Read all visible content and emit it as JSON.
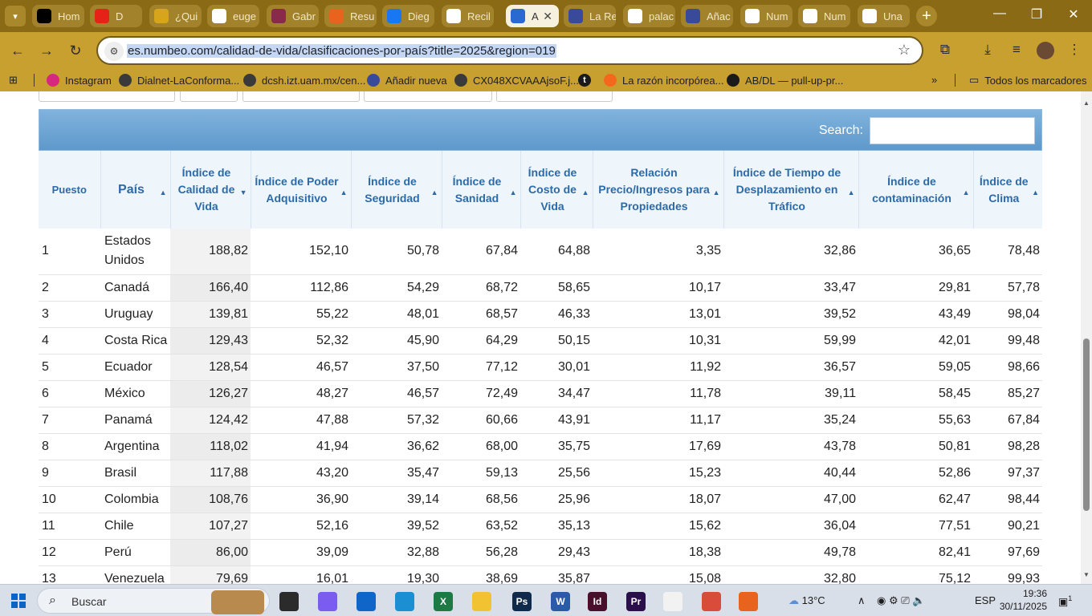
{
  "browser": {
    "tabs": [
      {
        "label": "Hom",
        "icon": "x-twitter-icon",
        "color": "#000000"
      },
      {
        "label": "D",
        "icon": "youtube-icon",
        "color": "#e62117"
      },
      {
        "label": "¿Qui",
        "icon": "coin-icon",
        "color": "#d7a51c"
      },
      {
        "label": "euge",
        "icon": "google-icon",
        "color": "#ffffff"
      },
      {
        "label": "Gabr",
        "icon": "uam-icon",
        "color": "#8a2a4a"
      },
      {
        "label": "Resu",
        "icon": "pdf-icon",
        "color": "#e8641e"
      },
      {
        "label": "Dieg",
        "icon": "facebook-icon",
        "color": "#1877f2"
      },
      {
        "label": "Recil",
        "icon": "gmail-icon",
        "color": "#ffffff"
      },
      {
        "label": "A",
        "icon": "numbeo-icon",
        "color": "#2a6ad0",
        "active": true
      },
      {
        "label": "La Re",
        "icon": "tab-icon",
        "color": "#3a4a9a"
      },
      {
        "label": "palac",
        "icon": "google-icon",
        "color": "#ffffff"
      },
      {
        "label": "Añac",
        "icon": "tab-icon",
        "color": "#3a4a9a"
      },
      {
        "label": "Num",
        "icon": "wikipedia-icon",
        "color": "#ffffff"
      },
      {
        "label": "Num",
        "icon": "wikipedia-icon",
        "color": "#ffffff"
      },
      {
        "label": "Una",
        "icon": "document-icon",
        "color": "#ffffff"
      }
    ],
    "url": "es.numbeo.com/calidad-de-vida/clasificaciones-por-país?title=2025&region=019",
    "bookmarks": [
      {
        "label": "Instagram",
        "color": "#d6287f"
      },
      {
        "label": "Dialnet-LaConforma...",
        "color": "#3a3a3a"
      },
      {
        "label": "dcsh.izt.uam.mx/cen...",
        "color": "#3a3a3a"
      },
      {
        "label": "Añadir nueva",
        "color": "#3a4a9a"
      },
      {
        "label": "CX048XCVAAAjsoF.j...",
        "color": "#3a3a3a"
      },
      {
        "label": "t",
        "color": "#1b1b1b"
      },
      {
        "label": "La razón incorpórea...",
        "color": "#f4681e"
      },
      {
        "label": "AB/DL — pull-up-pr...",
        "color": "#1b1b1b"
      }
    ],
    "bookmarks_overflow": "»",
    "all_bookmarks": "Todos los marcadores"
  },
  "search": {
    "label": "Search:",
    "value": ""
  },
  "table": {
    "headers": [
      "Puesto",
      "País",
      "Índice de Calidad de Vida",
      "Índice de Poder Adquisitivo",
      "Índice de Seguridad",
      "Índice de Sanidad",
      "Índice de Costo de Vida",
      "Relación Precio/Ingresos para Propiedades",
      "Índice de Tiempo de Desplazamiento en Tráfico",
      "Índice de contaminación",
      "Índice de Clima"
    ],
    "rows": [
      [
        "1",
        "Estados Unidos",
        "188,82",
        "152,10",
        "50,78",
        "67,84",
        "64,88",
        "3,35",
        "32,86",
        "36,65",
        "78,48"
      ],
      [
        "2",
        "Canadá",
        "166,40",
        "112,86",
        "54,29",
        "68,72",
        "58,65",
        "10,17",
        "33,47",
        "29,81",
        "57,78"
      ],
      [
        "3",
        "Uruguay",
        "139,81",
        "55,22",
        "48,01",
        "68,57",
        "46,33",
        "13,01",
        "39,52",
        "43,49",
        "98,04"
      ],
      [
        "4",
        "Costa Rica",
        "129,43",
        "52,32",
        "45,90",
        "64,29",
        "50,15",
        "10,31",
        "59,99",
        "42,01",
        "99,48"
      ],
      [
        "5",
        "Ecuador",
        "128,54",
        "46,57",
        "37,50",
        "77,12",
        "30,01",
        "11,92",
        "36,57",
        "59,05",
        "98,66"
      ],
      [
        "6",
        "México",
        "126,27",
        "48,27",
        "46,57",
        "72,49",
        "34,47",
        "11,78",
        "39,11",
        "58,45",
        "85,27"
      ],
      [
        "7",
        "Panamá",
        "124,42",
        "47,88",
        "57,32",
        "60,66",
        "43,91",
        "11,17",
        "35,24",
        "55,63",
        "67,84"
      ],
      [
        "8",
        "Argentina",
        "118,02",
        "41,94",
        "36,62",
        "68,00",
        "35,75",
        "17,69",
        "43,78",
        "50,81",
        "98,28"
      ],
      [
        "9",
        "Brasil",
        "117,88",
        "43,20",
        "35,47",
        "59,13",
        "25,56",
        "15,23",
        "40,44",
        "52,86",
        "97,37"
      ],
      [
        "10",
        "Colombia",
        "108,76",
        "36,90",
        "39,14",
        "68,56",
        "25,96",
        "18,07",
        "47,00",
        "62,47",
        "98,44"
      ],
      [
        "11",
        "Chile",
        "107,27",
        "52,16",
        "39,52",
        "63,52",
        "35,13",
        "15,62",
        "36,04",
        "77,51",
        "90,21"
      ],
      [
        "12",
        "Perú",
        "86,00",
        "39,09",
        "32,88",
        "56,28",
        "29,43",
        "18,38",
        "49,78",
        "82,41",
        "97,69"
      ],
      [
        "13",
        "Venezuela",
        "79,69",
        "16,01",
        "19,30",
        "38,69",
        "35,87",
        "15,08",
        "32,80",
        "75,12",
        "99,93"
      ]
    ]
  },
  "taskbar": {
    "search_placeholder": "Buscar",
    "weather": "13°C",
    "language": "ESP",
    "time": "19:36",
    "date": "30/11/2025",
    "notifications": "1",
    "apps": [
      {
        "label": "",
        "icon": "task-view-icon",
        "color": "#2b2b2b"
      },
      {
        "label": "",
        "icon": "copilot-icon",
        "color": "#7a5cf0"
      },
      {
        "label": "",
        "icon": "outlook-icon",
        "color": "#1066c8"
      },
      {
        "label": "",
        "icon": "edge-icon",
        "color": "#1b8fd2"
      },
      {
        "label": "X",
        "icon": "excel-icon",
        "color": "#1d7a45"
      },
      {
        "label": "",
        "icon": "file-explorer-icon",
        "color": "#f1c232"
      },
      {
        "label": "Ps",
        "icon": "photoshop-icon",
        "color": "#0f2a4a"
      },
      {
        "label": "W",
        "icon": "word-icon",
        "color": "#2b5aa8"
      },
      {
        "label": "Id",
        "icon": "indesign-icon",
        "color": "#4a0f2a"
      },
      {
        "label": "Pr",
        "icon": "premiere-icon",
        "color": "#2a0f4a"
      },
      {
        "label": "",
        "icon": "meet-icon",
        "color": "#f2f2f2"
      },
      {
        "label": "",
        "icon": "chrome-icon",
        "color": "#d94c3a"
      },
      {
        "label": "",
        "icon": "app-icon",
        "color": "#e8641e"
      }
    ]
  }
}
